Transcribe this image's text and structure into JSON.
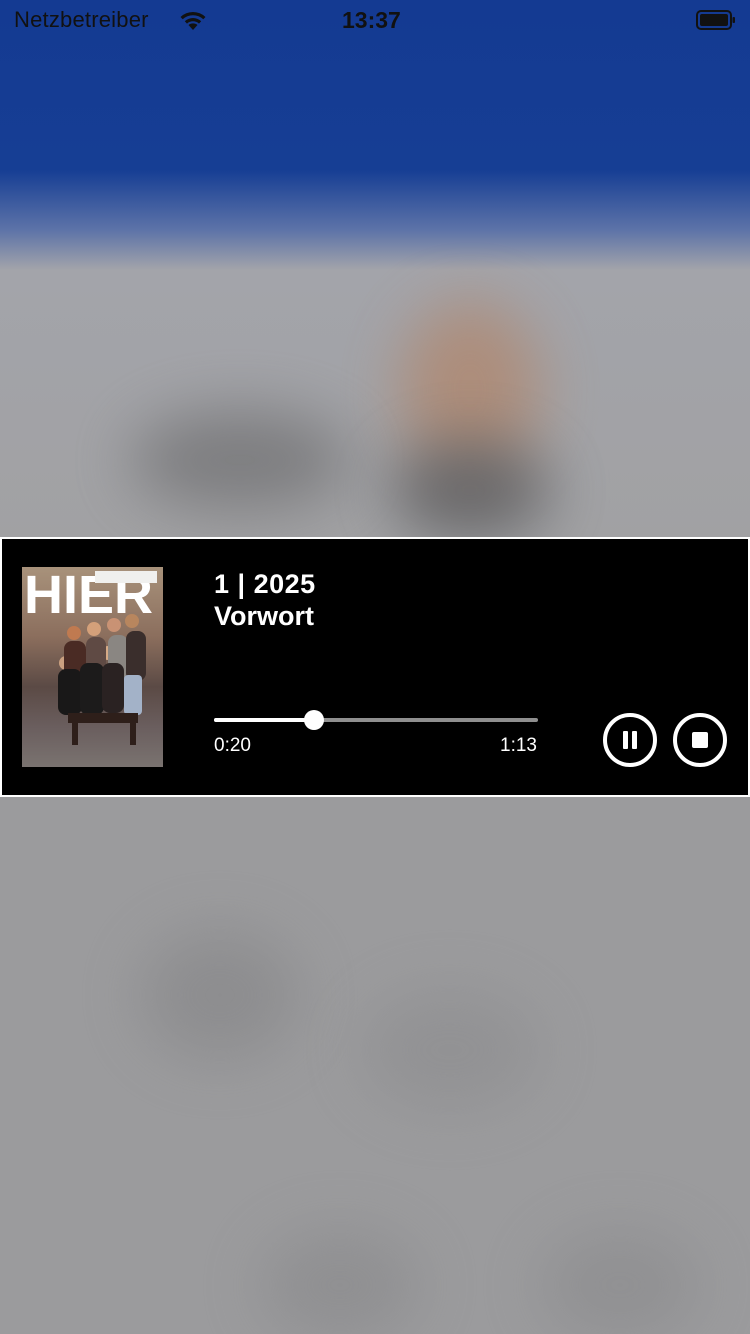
{
  "status_bar": {
    "carrier": "Netzbetreiber",
    "time": "13:37",
    "icons": [
      "wifi-icon",
      "battery-icon"
    ]
  },
  "player": {
    "cover": {
      "icon": "magazine-cover-image",
      "masthead": "HIER"
    },
    "title": "1 | 2025",
    "subtitle": "Vorwort",
    "progress": {
      "current": "0:20",
      "total": "1:13",
      "fraction": 0.31
    },
    "controls": {
      "pause_icon": "pause-icon",
      "stop_icon": "stop-icon"
    }
  }
}
